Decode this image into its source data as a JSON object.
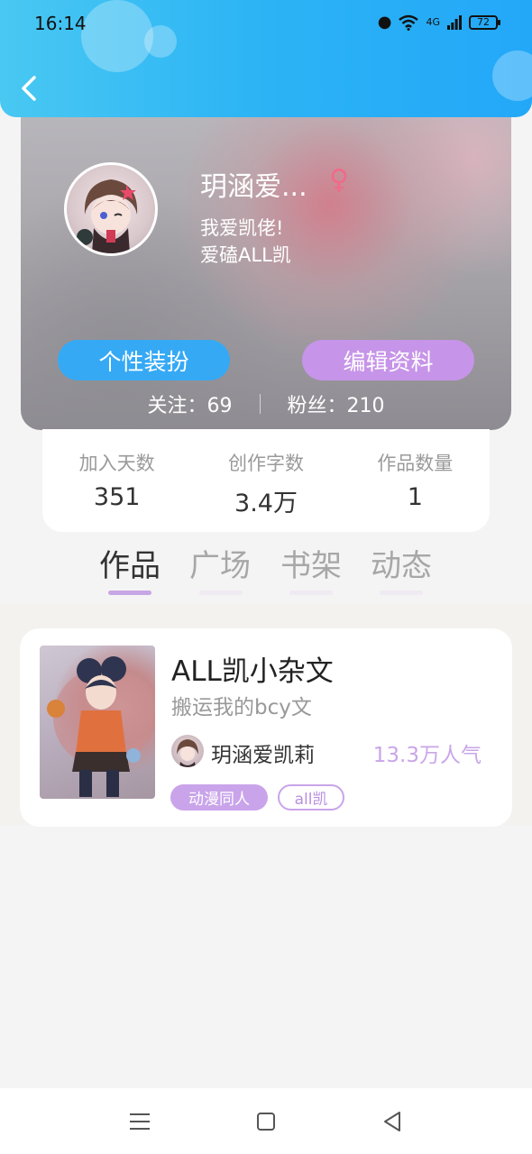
{
  "status_bar": {
    "time": "16:14",
    "network": "4G",
    "battery": "72"
  },
  "profile": {
    "username": "玥涵爱...",
    "gender_symbol": "♀",
    "bio": "我爱凯佬!\n爱磕ALL凯",
    "outfit_button": "个性装扮",
    "edit_button": "编辑资料",
    "following": "关注：69",
    "followers": "粉丝：210"
  },
  "stats": [
    {
      "label": "加入天数",
      "value": "351"
    },
    {
      "label": "创作字数",
      "value": "3.4万"
    },
    {
      "label": "作品数量",
      "value": "1"
    }
  ],
  "tabs": [
    {
      "label": "作品",
      "active": true
    },
    {
      "label": "广场",
      "active": false
    },
    {
      "label": "书架",
      "active": false
    },
    {
      "label": "动态",
      "active": false
    }
  ],
  "works": [
    {
      "title": "ALL凯小杂文",
      "subtitle": "搬运我的bcy文",
      "author": "玥涵爱凯莉",
      "popularity": "13.3万人气",
      "tags": [
        "动漫同人",
        "all凯"
      ]
    }
  ],
  "icons": {
    "back": "chevron-left-icon",
    "menu": "menu-icon",
    "home": "square-home-icon",
    "back_nav": "triangle-back-icon"
  },
  "colors": {
    "header": "#2bb3f5",
    "accent_blue": "#36a9f5",
    "accent_purple": "#c694e8"
  }
}
